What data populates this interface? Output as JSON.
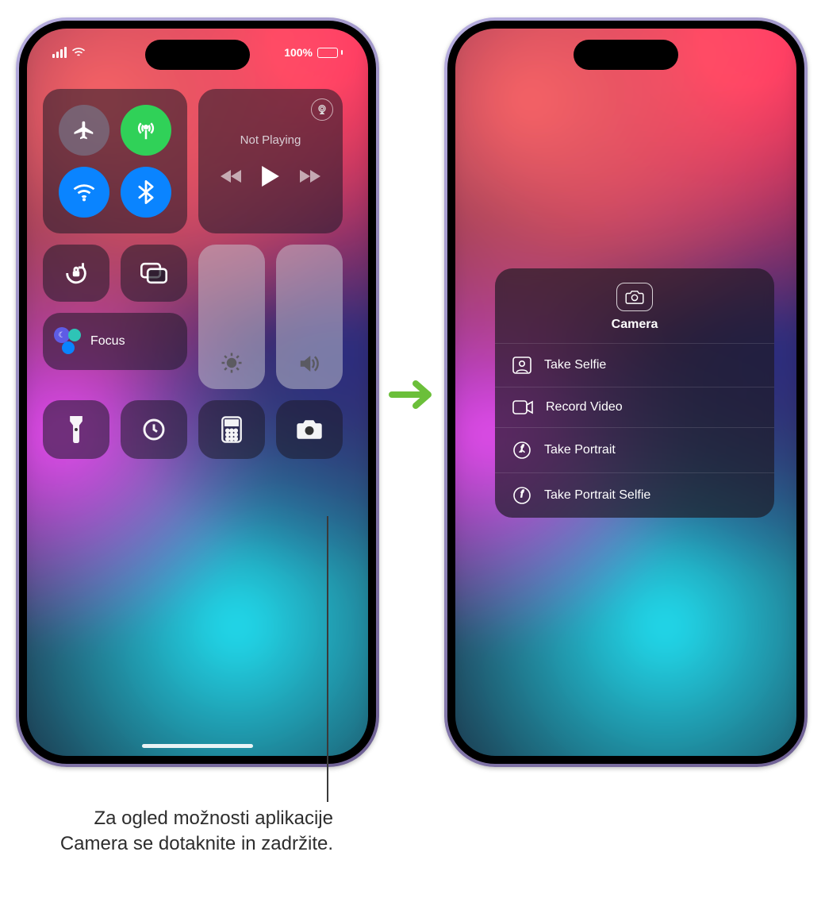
{
  "status": {
    "battery_pct": "100%"
  },
  "control_center": {
    "media": {
      "not_playing": "Not Playing"
    },
    "focus_label": "Focus",
    "icons": {
      "airplane": "airplane-icon",
      "cellular": "cellular-antenna-icon",
      "wifi": "wifi-icon",
      "bluetooth": "bluetooth-icon",
      "airplay": "airplay-icon",
      "prev": "previous-track-icon",
      "play": "play-icon",
      "next": "next-track-icon",
      "orientation_lock": "orientation-lock-icon",
      "screen_mirroring": "screen-mirroring-icon",
      "brightness": "brightness-icon",
      "volume": "volume-icon",
      "flashlight": "flashlight-icon",
      "timer": "timer-icon",
      "calculator": "calculator-icon",
      "camera": "camera-icon"
    }
  },
  "camera_menu": {
    "title": "Camera",
    "items": [
      {
        "icon": "selfie-icon",
        "label": "Take Selfie"
      },
      {
        "icon": "video-icon",
        "label": "Record Video"
      },
      {
        "icon": "portrait-icon",
        "label": "Take Portrait"
      },
      {
        "icon": "portrait-selfie-icon",
        "label": "Take Portrait Selfie"
      }
    ]
  },
  "arrow_icon": "arrow-right-icon",
  "callout": "Za ogled možnosti aplikacije Camera se dotaknite in zadržite."
}
